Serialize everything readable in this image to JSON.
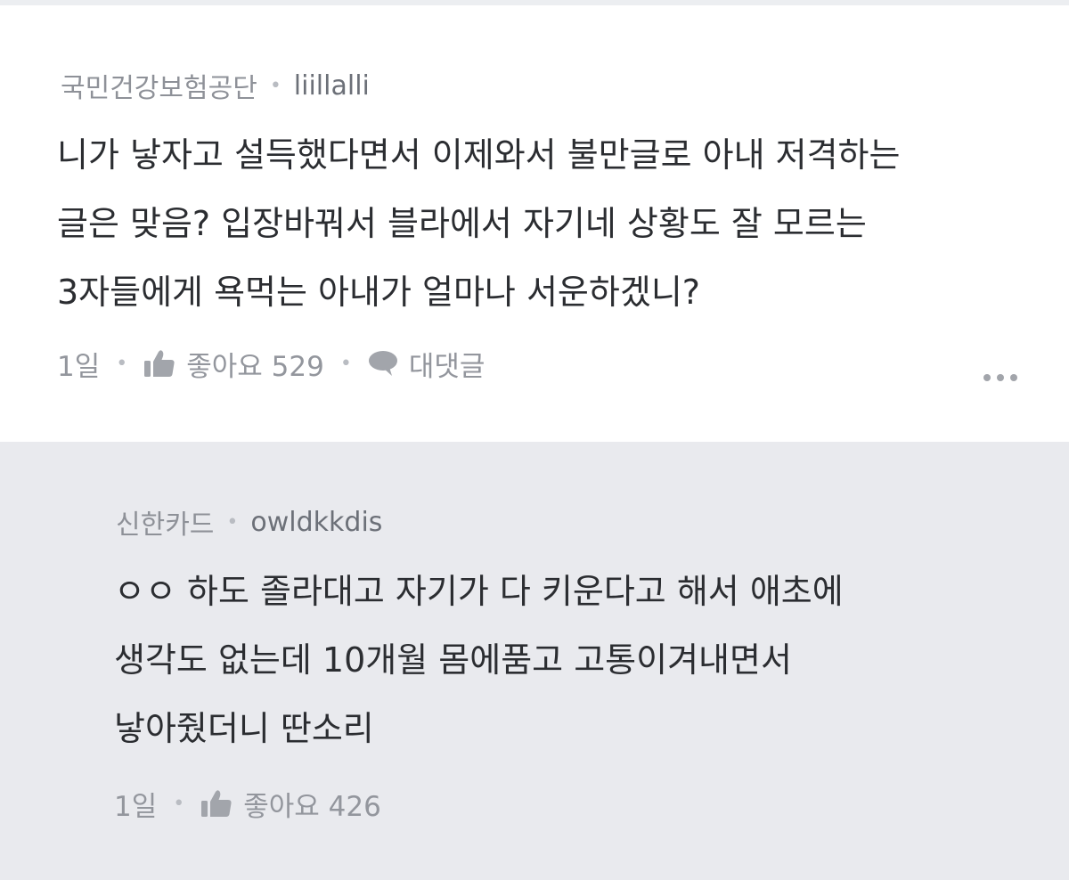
{
  "comment": {
    "company": "국민건강보험공단",
    "nickname": "liillalli",
    "body_lines": [
      "니가 낳자고 설득했다면서 이제와서 불만글로 아내 저격하는",
      "글은 맞음? 입장바꿔서 블라에서 자기네 상황도 잘 모르는",
      "3자들에게 욕먹는 아내가 얼마나 서운하겠니?"
    ],
    "time": "1일",
    "like_label": "좋아요 529",
    "reply_label": "대댓글",
    "icons": [
      "thumbs-up-icon",
      "speech-bubble-icon",
      "more-options-icon"
    ]
  },
  "reply": {
    "company": "신한카드",
    "nickname": "owldkkdis",
    "body_lines": [
      "ㅇㅇ 하도 졸라대고 자기가 다 키운다고 해서 애초에",
      "생각도 없는데 10개월 몸에품고 고통이겨내면서",
      "낳아줬더니 딴소리"
    ],
    "time": "1일",
    "like_label": "좋아요 426",
    "icons": [
      "thumbs-up-icon"
    ]
  },
  "colors": {
    "background": "#ffffff",
    "reply_background": "#e9eaee",
    "body_text": "#2b2d31",
    "meta_text": "#8e9198"
  }
}
